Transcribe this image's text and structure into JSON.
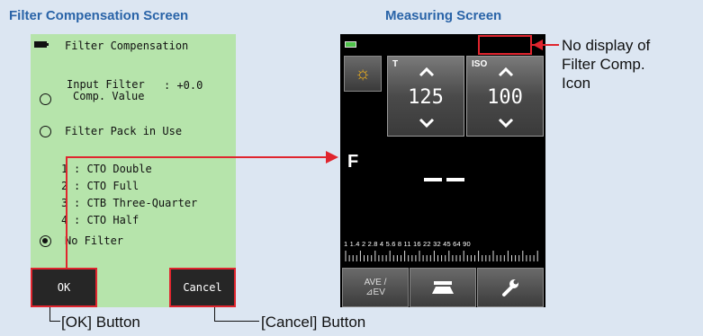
{
  "captions": {
    "left": "Filter Compensation Screen",
    "right": "Measuring Screen"
  },
  "filter_screen": {
    "title": "Filter Compensation",
    "input_filter_label_line1": "Input Filter",
    "input_filter_label_line2": "Comp. Value",
    "input_filter_value": ": +0.0",
    "filter_pack_label": "Filter Pack in Use",
    "filters": [
      {
        "num": "1",
        "text": ": CTO Double"
      },
      {
        "num": "2",
        "text": ": CTO Full"
      },
      {
        "num": "3",
        "text": ": CTB Three-Quarter"
      },
      {
        "num": "4",
        "text": ": CTO Half"
      }
    ],
    "no_filter_label": "No Filter",
    "ok_label": "OK",
    "cancel_label": "Cancel"
  },
  "measuring_screen": {
    "t_label": "T",
    "t_value": "125",
    "iso_label": "ISO",
    "iso_value": "100",
    "f_label": "F",
    "scale_numbers": "1  1.4  2  2.8  4  5.6  8  11  16  22  32  45  64  90",
    "ave_label_line1": "AVE /",
    "ave_label_line2": "⊿EV"
  },
  "annotations": {
    "no_display": "No display of\nFilter Comp.\nIcon",
    "ok_button": "[OK] Button",
    "cancel_button": "[Cancel] Button"
  },
  "colors": {
    "filter_bg": "#b6e4ab",
    "accent_red": "#e0252e",
    "caption_blue": "#2a64a8"
  }
}
